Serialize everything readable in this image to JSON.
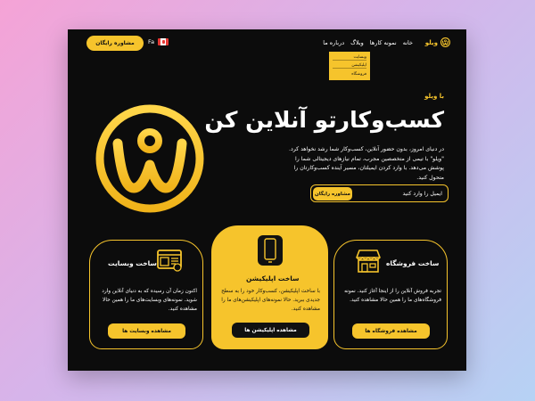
{
  "header": {
    "cta_label": "مشاوره رایگان",
    "lang_label": "Fa",
    "nav": [
      "خانه",
      "نمونه کارها",
      "وبلاگ",
      "درباره ما"
    ],
    "brand_name": "ویلو",
    "dropdown": [
      "وبسایت",
      "اپلیکیشن",
      "فروشگاه"
    ]
  },
  "hero": {
    "kicker": "با ویلو",
    "title": "کسب‌وکارتو آنلاین کن",
    "description": "در دنیای امروز، بدون حضور آنلاین، کسب‌وکار شما رشد نخواهد کرد. \"ویلو\" با تیمی از متخصصین مجرب، تمام نیازهای دیجیتالی شما را پوشش می‌دهد. با وارد کردن ایمیلتان، مسیر آینده کسب‌وکارتان را متحول کنید.",
    "email_placeholder": "ایمیل را وارد کنید",
    "email_button": "مشاوره رایگان"
  },
  "cards": {
    "website": {
      "title": "ساخت وبسایت",
      "text": "اکنون زمان آن رسیده که به دنیای آنلاین وارد شوید. نمونه‌های وبسایت‌های ما را همین حالا مشاهده کنید.",
      "button": "مشاهده وبسایت ها"
    },
    "app": {
      "title": "ساخت اپلیکیشن",
      "text": "با ساخت اپلیکیشن، کسب‌وکار خود را به سطح جدیدی ببرید. حالا نمونه‌های اپلیکیشن‌های ما را مشاهده کنید.",
      "button": "مشاهده اپلیکیشن ها"
    },
    "store": {
      "title": "ساخت فروشگاه",
      "text": "تجربه فروش آنلاین را از اینجا آغاز کنید. نمونه فروشگاه‌های ما را همین حالا مشاهده کنید.",
      "button": "مشاهده فروشگاه ها"
    }
  },
  "colors": {
    "accent": "#f6c42c",
    "background": "#0c0c0c",
    "text": "#ffffff"
  }
}
